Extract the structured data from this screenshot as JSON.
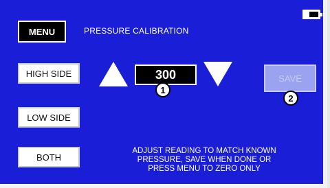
{
  "header": {
    "menu_label": "MENU",
    "title": "PRESSURE CALIBRATION",
    "battery_icon": "battery-icon"
  },
  "side_buttons": [
    {
      "label": "HIGH SIDE"
    },
    {
      "label": "LOW SIDE"
    },
    {
      "label": "BOTH"
    }
  ],
  "adjust": {
    "value": "300",
    "up_icon": "triangle-up-icon",
    "down_icon": "triangle-down-icon"
  },
  "save": {
    "label": "SAVE",
    "enabled": false
  },
  "callouts": [
    "1",
    "2"
  ],
  "instructions": {
    "line1": "ADJUST READING TO MATCH KNOWN",
    "line2": "PRESSURE, SAVE WHEN DONE OR",
    "line3": "PRESS MENU TO ZERO ONLY"
  },
  "colors": {
    "screen_bg": "#1a1ed6",
    "save_disabled": "#9ba2f0"
  }
}
